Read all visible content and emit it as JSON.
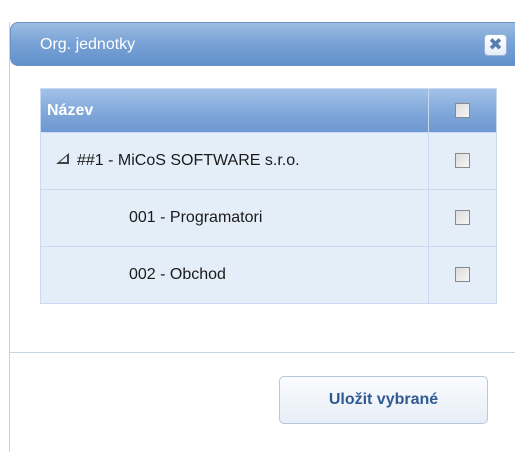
{
  "dialog": {
    "title": "Org. jednotky",
    "close_glyph": "✖"
  },
  "grid": {
    "header": {
      "name_label": "Název"
    },
    "rows": [
      {
        "label": "##1 - MiCoS SOFTWARE s.r.o.",
        "level": 0,
        "expanded": true,
        "checked": false
      },
      {
        "label": "001 - Programatori",
        "level": 1,
        "checked": false
      },
      {
        "label": "002 - Obchod",
        "level": 1,
        "checked": false
      }
    ]
  },
  "footer": {
    "save_label": "Uložit vybrané"
  },
  "colors": {
    "titlebar": "#7aa3d6",
    "header": "#7fa7d9",
    "row_bg": "#e4eef9",
    "button_text": "#2f5b93"
  }
}
